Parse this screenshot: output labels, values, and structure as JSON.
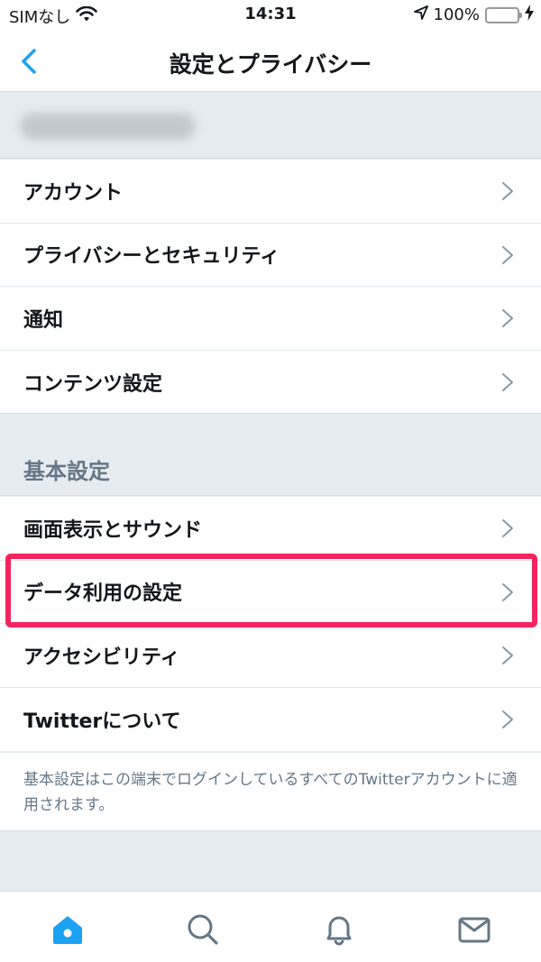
{
  "status_bar": {
    "carrier": "SIMなし",
    "time": "14:31",
    "battery_percent": "100%",
    "icons": [
      "wifi-icon",
      "location-arrow-icon",
      "battery-icon",
      "charging-bolt-icon"
    ],
    "battery_level": 1.0
  },
  "nav": {
    "title": "設定とプライバシー",
    "back_icon": "chevron-left-icon"
  },
  "account": {
    "name_blurred": true
  },
  "account_settings": [
    {
      "label": "アカウント"
    },
    {
      "label": "プライバシーとセキュリティ"
    },
    {
      "label": "通知"
    },
    {
      "label": "コンテンツ設定"
    }
  ],
  "general": {
    "header": "基本設定",
    "items": [
      {
        "label": "画面表示とサウンド"
      },
      {
        "label": "データ利用の設定"
      },
      {
        "label": "アクセシビリティ"
      },
      {
        "label": "Twitterについて"
      }
    ],
    "highlighted_item": "データ利用の設定",
    "note": "基本設定はこの端末でログインしているすべてのTwitterアカウントに適用されます。"
  },
  "tab_bar": {
    "tabs": [
      {
        "icon": "home-icon",
        "active": true
      },
      {
        "icon": "search-icon",
        "active": false
      },
      {
        "icon": "bell-icon",
        "active": false
      },
      {
        "icon": "mail-icon",
        "active": false
      }
    ]
  },
  "colors": {
    "accent": "#1da1f2",
    "highlight": "#f5245f",
    "background": "#e6ecf0",
    "secondary_text": "#657786",
    "battery": "#4cd964"
  }
}
